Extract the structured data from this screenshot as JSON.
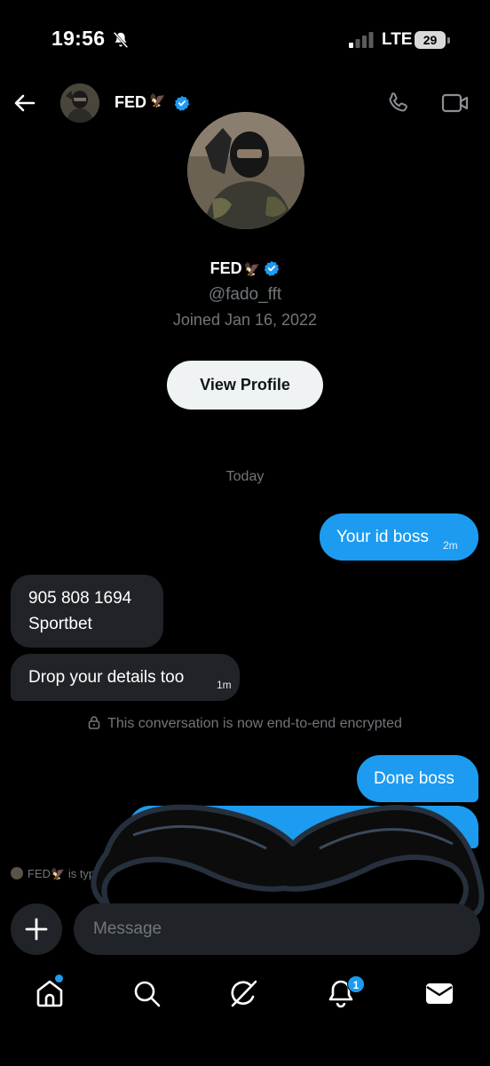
{
  "status_bar": {
    "time": "19:56",
    "network": "LTE",
    "battery": "29"
  },
  "header": {
    "name": "FED",
    "emoji": "🦅"
  },
  "profile": {
    "name": "FED",
    "emoji": "🦅",
    "handle": "@fado_fft",
    "joined": "Joined Jan 16, 2022",
    "view_profile_label": "View Profile"
  },
  "conversation": {
    "day_label": "Today",
    "messages": [
      {
        "text": "Your id boss",
        "time": "2m"
      },
      {
        "line1": "905 808 1694",
        "line2": "Sportbet"
      },
      {
        "text": "Drop your details too",
        "time": "1m"
      },
      {
        "text": "Done boss"
      }
    ],
    "encryption_notice": "This conversation is now end-to-end encrypted",
    "typing": {
      "name": "FED",
      "emoji": "🦅",
      "text": "is typ"
    }
  },
  "composer": {
    "placeholder": "Message"
  },
  "nav": {
    "notifications_badge": "1"
  },
  "colors": {
    "accent": "#1d9bf0",
    "bubble_received": "#202327",
    "background": "#000000"
  }
}
